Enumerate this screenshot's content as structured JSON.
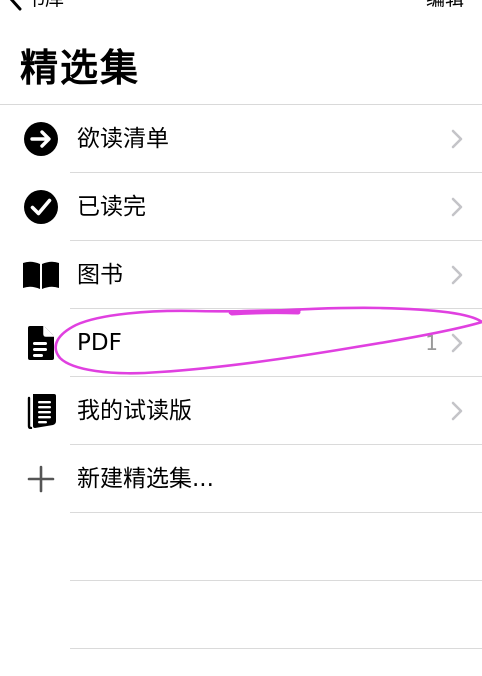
{
  "nav": {
    "back_label": "书库",
    "edit_label": "编辑"
  },
  "title": "精选集",
  "items": [
    {
      "label": "欲读清单",
      "icon": "arrow-circle-icon",
      "count": ""
    },
    {
      "label": "已读完",
      "icon": "checkmark-circle-icon",
      "count": ""
    },
    {
      "label": "图书",
      "icon": "book-icon",
      "count": ""
    },
    {
      "label": "PDF",
      "icon": "document-icon",
      "count": "1"
    },
    {
      "label": "我的试读版",
      "icon": "samples-icon",
      "count": ""
    }
  ],
  "new_collection": {
    "label": "新建精选集...",
    "icon": "plus-icon"
  },
  "colors": {
    "annotation": "#e040e0",
    "separator": "#dadada",
    "chevron": "#c4c4c8"
  }
}
